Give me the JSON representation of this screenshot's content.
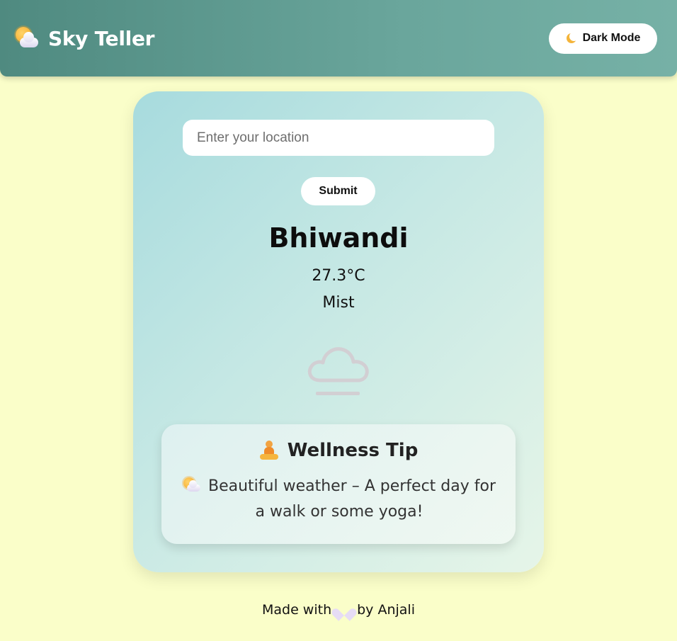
{
  "header": {
    "title": "Sky Teller",
    "logo_icon": "sun-behind-cloud-icon",
    "dark_mode_label": "Dark Mode",
    "dark_mode_icon": "crescent-moon-icon"
  },
  "search": {
    "placeholder": "Enter your location",
    "value": "",
    "submit_label": "Submit"
  },
  "weather": {
    "city": "Bhiwandi",
    "temperature": "27.3°C",
    "condition": "Mist",
    "condition_icon": "mist-icon"
  },
  "wellness": {
    "title": "Wellness Tip",
    "title_icon": "yoga-icon",
    "message_icon": "sun-behind-cloud-icon",
    "message": "Beautiful weather – A perfect day for a walk or some yoga!"
  },
  "footer": {
    "prefix": "Made with",
    "heart_icon": "heart-icon",
    "suffix": "by Anjali"
  },
  "colors": {
    "page_bg": "#fafec9",
    "header_bg": "#5f988e",
    "card_bg": "#b9e2e2"
  }
}
